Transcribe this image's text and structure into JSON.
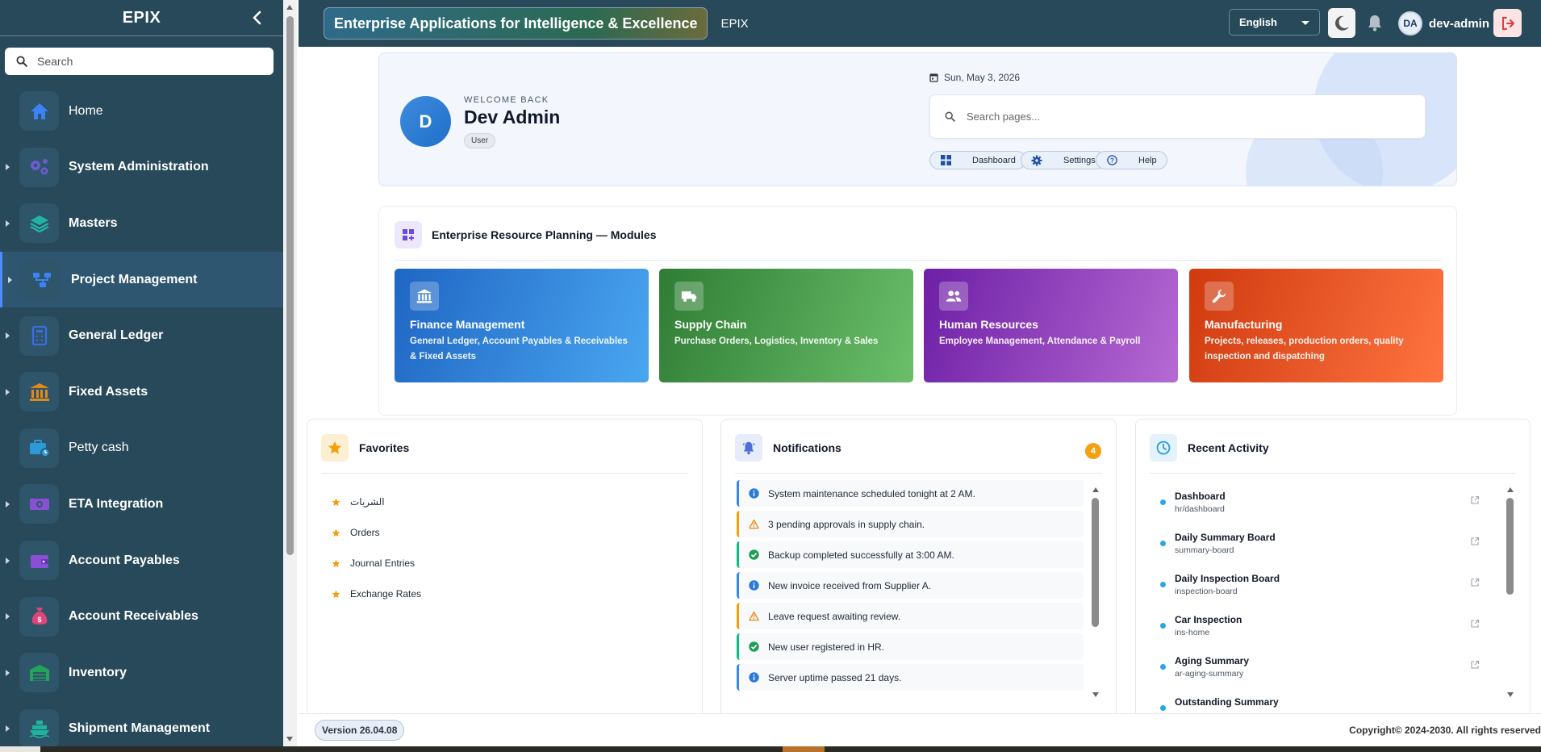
{
  "sidebar": {
    "title": "EPIX",
    "search_placeholder": "Search",
    "items": [
      {
        "label": "Home",
        "icon": "home-icon",
        "color": "#3b82f6",
        "caret": false
      },
      {
        "label": "System Administration",
        "icon": "gears-icon",
        "color": "#6d5bd0",
        "caret": true
      },
      {
        "label": "Masters",
        "icon": "layers-icon",
        "color": "#22b3a7",
        "caret": true
      },
      {
        "label": "Project Management",
        "icon": "sitemap-icon",
        "color": "#3b82f6",
        "caret": true,
        "active": true
      },
      {
        "label": "General Ledger",
        "icon": "ledger-icon",
        "color": "#3b6fe0",
        "caret": true
      },
      {
        "label": "Fixed Assets",
        "icon": "bank-icon",
        "color": "#e08a1c",
        "caret": true
      },
      {
        "label": "Petty cash",
        "icon": "cash-icon",
        "color": "#2b9ad6",
        "caret": false
      },
      {
        "label": "ETA Integration",
        "icon": "money-icon",
        "color": "#8b4fd6",
        "caret": true
      },
      {
        "label": "Account Payables",
        "icon": "wallet-icon",
        "color": "#8b4fd6",
        "caret": true
      },
      {
        "label": "Account Receivables",
        "icon": "money-bag-icon",
        "color": "#e0457a",
        "caret": true
      },
      {
        "label": "Inventory",
        "icon": "warehouse-icon",
        "color": "#22a55a",
        "caret": true
      },
      {
        "label": "Shipment Management",
        "icon": "ship-icon",
        "color": "#20b39d",
        "caret": true
      }
    ]
  },
  "topbar": {
    "app_title": "Enterprise Applications for Intelligence & Excellence",
    "app_short": "EPIX",
    "language": "English",
    "user_initials": "DA",
    "user_name": "dev-admin"
  },
  "hero": {
    "avatar_letter": "D",
    "welcome": "WELCOME BACK",
    "user_display_name": "Dev Admin",
    "role": "User",
    "date": "Sun, May 3, 2026",
    "search_placeholder": "Search pages...",
    "quick_links": [
      {
        "label": "Dashboard",
        "icon": "dashboard-icon"
      },
      {
        "label": "Settings",
        "icon": "gear-icon"
      },
      {
        "label": "Help",
        "icon": "help-icon"
      }
    ]
  },
  "modules": {
    "title": "Enterprise Resource Planning — Modules",
    "cards": [
      {
        "title": "Finance Management",
        "desc": "General Ledger, Account Payables & Receivables & Fixed Assets",
        "icon": "bank-icon"
      },
      {
        "title": "Supply Chain",
        "desc": "Purchase Orders, Logistics, Inventory & Sales",
        "icon": "truck-icon"
      },
      {
        "title": "Human Resources",
        "desc": "Employee Management, Attendance & Payroll",
        "icon": "users-icon"
      },
      {
        "title": "Manufacturing",
        "desc": "Projects, releases, production orders, quality inspection and dispatching",
        "icon": "wrench-icon"
      }
    ]
  },
  "favorites": {
    "title": "Favorites",
    "items": [
      "الشريات",
      "Orders",
      "Journal Entries",
      "Exchange Rates"
    ]
  },
  "notifications": {
    "title": "Notifications",
    "count": "4",
    "items": [
      {
        "text": "System maintenance scheduled tonight at 2 AM.",
        "type": "info"
      },
      {
        "text": "3 pending approvals in supply chain.",
        "type": "warn"
      },
      {
        "text": "Backup completed successfully at 3:00 AM.",
        "type": "ok"
      },
      {
        "text": "New invoice received from Supplier A.",
        "type": "info"
      },
      {
        "text": "Leave request awaiting review.",
        "type": "warn"
      },
      {
        "text": "New user registered in HR.",
        "type": "ok"
      },
      {
        "text": "Server uptime passed 21 days.",
        "type": "info"
      }
    ]
  },
  "recent_activity": {
    "title": "Recent Activity",
    "items": [
      {
        "title": "Dashboard",
        "path": "hr/dashboard"
      },
      {
        "title": "Daily Summary Board",
        "path": "summary-board"
      },
      {
        "title": "Daily Inspection Board",
        "path": "inspection-board"
      },
      {
        "title": "Car Inspection",
        "path": "ins-home"
      },
      {
        "title": "Aging Summary",
        "path": "ar-aging-summary"
      },
      {
        "title": "Outstanding Summary",
        "path": ""
      }
    ]
  },
  "footer": {
    "version": "Version 26.04.08",
    "copyright": "Copyright© 2024-2030. All rights reserved"
  }
}
